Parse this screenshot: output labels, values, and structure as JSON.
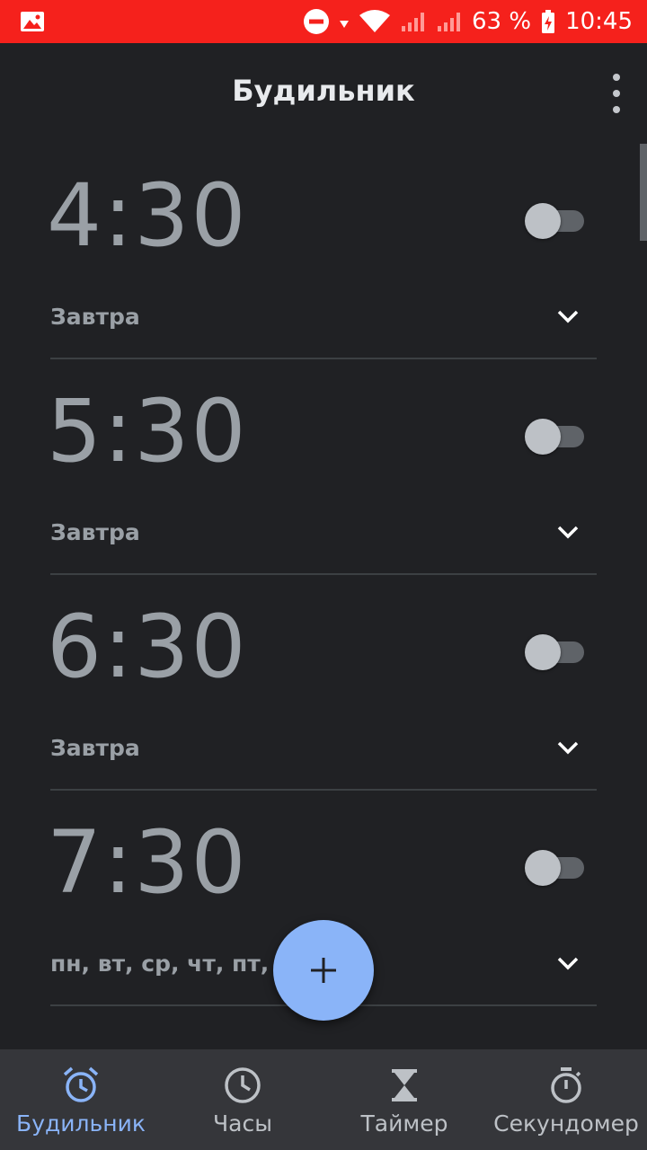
{
  "status_bar": {
    "battery": "63 %",
    "time": "10:45"
  },
  "app_bar": {
    "title": "Будильник"
  },
  "alarms": [
    {
      "time": "4:30",
      "days": "Завтра",
      "enabled": false
    },
    {
      "time": "5:30",
      "days": "Завтра",
      "enabled": false
    },
    {
      "time": "6:30",
      "days": "Завтра",
      "enabled": false
    },
    {
      "time": "7:30",
      "days": "пн, вт, ср, чт, пт, сб",
      "enabled": false
    }
  ],
  "fab": {
    "icon": "plus-icon"
  },
  "bottom_nav": {
    "items": [
      {
        "label": "Будильник",
        "icon": "alarm-clock-icon",
        "active": true
      },
      {
        "label": "Часы",
        "icon": "clock-icon",
        "active": false
      },
      {
        "label": "Таймер",
        "icon": "hourglass-icon",
        "active": false
      },
      {
        "label": "Секундомер",
        "icon": "stopwatch-icon",
        "active": false
      }
    ]
  },
  "colors": {
    "status_bar": "#f5211c",
    "background": "#202124",
    "accent": "#8ab4f8",
    "nav_background": "#35363a"
  }
}
